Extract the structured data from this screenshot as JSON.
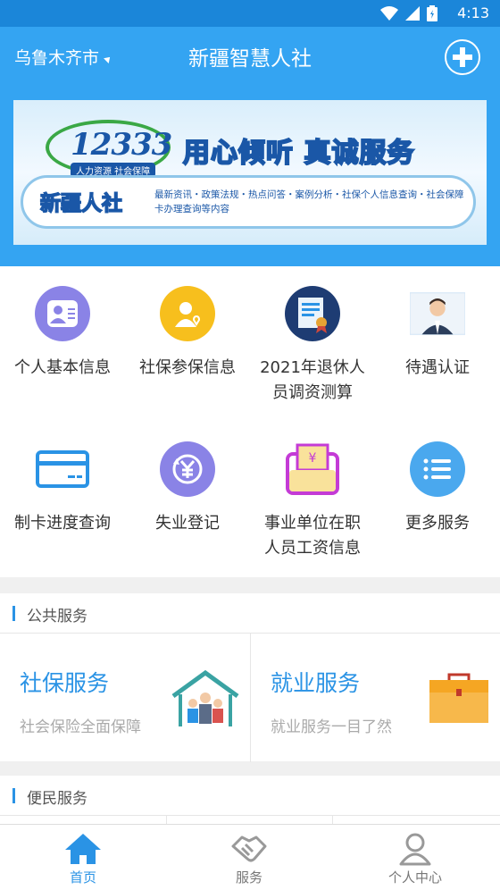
{
  "status_bar": {
    "time": "4:13"
  },
  "header": {
    "city": "乌鲁木齐市",
    "title": "新疆智慧人社"
  },
  "banner": {
    "hotline": "12333",
    "hotline_sub": "人力资源 社会保障",
    "slogan": "用心倾听 真诚服务",
    "brand": "新疆人社",
    "description": "最新资讯・政策法规・热点问答・案例分析・社保个人信息查询・社会保障卡办理查询等内容"
  },
  "grid": [
    {
      "label": "个人基本信息",
      "icon": "person-card-icon",
      "color": "#8a83e6"
    },
    {
      "label": "社保参保信息",
      "icon": "person-heart-icon",
      "color": "#f7bf1d"
    },
    {
      "label": "2021年退休人员调资测算",
      "icon": "certificate-icon",
      "color": "#1e3c73"
    },
    {
      "label": "待遇认证",
      "icon": "face-photo-icon",
      "color": "#cfe4f5"
    },
    {
      "label": "制卡进度查询",
      "icon": "card-icon",
      "color": "#2a93e5"
    },
    {
      "label": "失业登记",
      "icon": "yuan-refresh-icon",
      "color": "#8a83e6"
    },
    {
      "label": "事业单位在职人员工资信息",
      "icon": "wallet-yuan-icon",
      "color": "#c43bd6"
    },
    {
      "label": "更多服务",
      "icon": "list-icon",
      "color": "#4aa8ee"
    }
  ],
  "sections": {
    "public": "公共服务",
    "convenience": "便民服务"
  },
  "cards": [
    {
      "title": "社保服务",
      "subtitle": "社会保险全面保障",
      "icon": "family-house-icon"
    },
    {
      "title": "就业服务",
      "subtitle": "就业服务一目了然",
      "icon": "briefcase-icon"
    }
  ],
  "tabs": [
    {
      "label": "首页",
      "icon": "home-icon",
      "active": true
    },
    {
      "label": "服务",
      "icon": "handshake-icon",
      "active": false
    },
    {
      "label": "个人中心",
      "icon": "user-icon",
      "active": false
    }
  ],
  "colors": {
    "primary": "#34a4f2",
    "accent": "#2a93e5"
  }
}
